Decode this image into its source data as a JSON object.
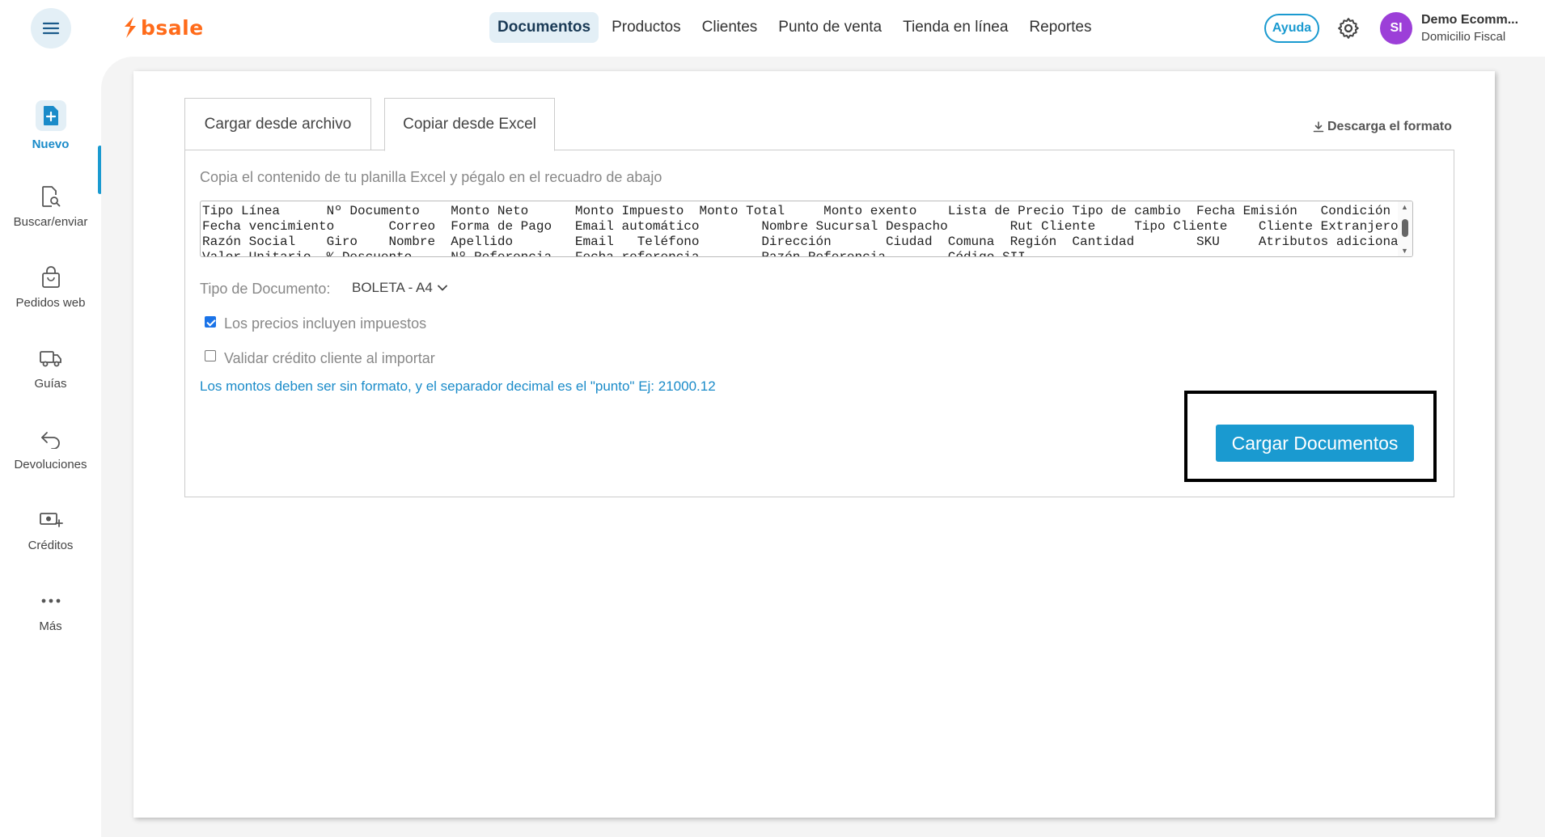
{
  "app": {
    "logo_text": "bsale"
  },
  "nav": {
    "items": [
      {
        "label": "Documentos",
        "active": true
      },
      {
        "label": "Productos"
      },
      {
        "label": "Clientes"
      },
      {
        "label": "Punto de venta"
      },
      {
        "label": "Tienda en línea"
      },
      {
        "label": "Reportes"
      }
    ]
  },
  "header": {
    "help_label": "Ayuda",
    "avatar_initials": "SI",
    "user_name": "Demo Ecomm...",
    "user_sub": "Domicilio Fiscal"
  },
  "sidebar": {
    "items": [
      {
        "label": "Nuevo",
        "icon": "new-document-icon",
        "active": true
      },
      {
        "label": "Buscar/enviar",
        "icon": "search-document-icon"
      },
      {
        "label": "Pedidos web",
        "icon": "shopping-bag-icon"
      },
      {
        "label": "Guías",
        "icon": "truck-icon"
      },
      {
        "label": "Devoluciones",
        "icon": "return-arrow-icon"
      },
      {
        "label": "Créditos",
        "icon": "money-plus-icon"
      },
      {
        "label": "Más",
        "icon": "more-dots-icon"
      }
    ]
  },
  "tabs": [
    {
      "label": "Cargar desde archivo"
    },
    {
      "label": "Copiar desde Excel",
      "active": true
    }
  ],
  "download_label": "Descarga el formato",
  "form": {
    "instructions": "Copia el contenido de tu planilla Excel y pégalo en el recuadro de abajo",
    "textarea_lines": [
      "Tipo Línea      Nº Documento    Monto Neto      Monto Impuesto  Monto Total     Monto exento    Lista de Precio Tipo de cambio  Fecha Emisión   Condición Venta",
      "Fecha vencimiento       Correo  Forma de Pago   Email automático        Nombre Sucursal Despacho        Rut Cliente     Tipo Cliente    Cliente Extranjero",
      "Razón Social    Giro    Nombre  Apellido        Email   Teléfono        Dirección       Ciudad  Comuna  Región  Cantidad        SKU     Atributos adicionales",
      "Valor Unitario  % Descuento     Nº Referencia   Fecha referencia        Razón Referencia        Código SII"
    ],
    "doc_type_label": "Tipo de Documento:",
    "doc_type_value": "BOLETA - A4",
    "checkbox_taxes_label": "Los precios incluyen impuestos",
    "checkbox_taxes_checked": true,
    "checkbox_credit_label": "Validar crédito cliente al importar",
    "checkbox_credit_checked": false,
    "note": "Los montos deben ser sin formato, y el separador decimal es el \"punto\" Ej: 21000.12",
    "submit_label": "Cargar Documentos"
  },
  "colors": {
    "accent": "#1a9ad0",
    "brand": "#ff6b1a",
    "avatar": "#9c3fd8",
    "nav_active_bg": "#e3eff6"
  }
}
